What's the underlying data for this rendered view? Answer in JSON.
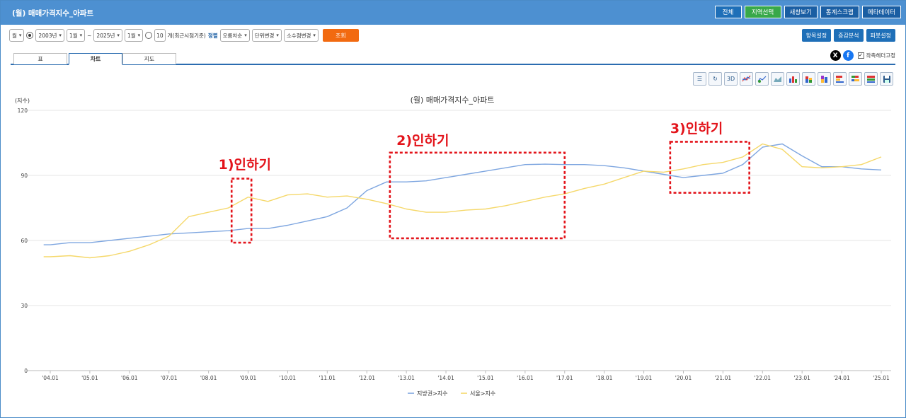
{
  "header": {
    "title": "(월) 매매가격지수_아파트",
    "buttons": [
      "전체",
      "지역선택",
      "새창보기",
      "통계스크랩",
      "메타데이터"
    ]
  },
  "controls": {
    "period": "월",
    "start_year": "2003년",
    "start_month": "1월",
    "tilde": "~",
    "end_year": "2025년",
    "end_month": "1월",
    "count_value": "10",
    "count_label": "개(최근시점기준)",
    "sort_label": "정렬",
    "sort_value": "오름차순",
    "unit_change": "단위변경",
    "decimal_change": "소수점변경",
    "search_button": "조회"
  },
  "right_buttons": [
    "항목설정",
    "증감분석",
    "피봇설정"
  ],
  "tabs": [
    {
      "label": "표",
      "active": false
    },
    {
      "label": "차트",
      "active": true
    },
    {
      "label": "지도",
      "active": false
    }
  ],
  "social": {
    "x_icon": "x-icon",
    "fb_icon": "facebook-icon",
    "fixed_header_label": "좌측헤더고정",
    "fixed_header_checked": true
  },
  "toolbar": [
    "list-icon",
    "refresh-icon",
    "3d-icon",
    "line-chart-icon",
    "line-chart-alt-icon",
    "area-chart-icon",
    "bar-chart-icon",
    "stacked-bar-icon",
    "stacked-bar-alt-icon",
    "horizontal-bar-icon",
    "horizontal-bar-alt-icon",
    "percent-bar-icon",
    "save-icon"
  ],
  "toolbar_text": {
    "three_d": "3D"
  },
  "colors": {
    "header": "#4d90d1",
    "series1": "#7ea6e0",
    "series2": "#f5d86a",
    "annotation": "#e3141b",
    "search": "#f26a10"
  },
  "chart_data": {
    "type": "line",
    "title": "(월) 매매가격지수_아파트",
    "ylabel": "(지수)",
    "ylim": [
      0,
      120
    ],
    "yticks": [
      "120",
      "90",
      "60",
      "30",
      "0"
    ],
    "xticks": [
      "'04.01",
      "'05.01",
      "'06.01",
      "'07.01",
      "'08.01",
      "'09.01",
      "'10.01",
      "'11.01",
      "'12.01",
      "'13.01",
      "'14.01",
      "'15.01",
      "'16.01",
      "'17.01",
      "'18.01",
      "'19.01",
      "'20.01",
      "'21.01",
      "'22.01",
      "'23.01",
      "'24.01",
      "'25.01"
    ],
    "x": [
      "'03.11",
      "'04.01",
      "'04.07",
      "'05.01",
      "'05.07",
      "'06.01",
      "'06.07",
      "'07.01",
      "'07.07",
      "'08.01",
      "'08.07",
      "'09.01",
      "'09.07",
      "'10.01",
      "'10.07",
      "'11.01",
      "'11.07",
      "'12.01",
      "'12.07",
      "'13.01",
      "'13.07",
      "'14.01",
      "'14.07",
      "'15.01",
      "'15.07",
      "'16.01",
      "'16.07",
      "'17.01",
      "'17.07",
      "'18.01",
      "'18.07",
      "'19.01",
      "'19.07",
      "'20.01",
      "'20.07",
      "'21.01",
      "'21.07",
      "'22.01",
      "'22.07",
      "'23.01",
      "'23.07",
      "'24.01",
      "'24.07",
      "'25.01"
    ],
    "series": [
      {
        "name": "지방권>지수",
        "color": "#7ea6e0",
        "values": [
          58,
          58,
          59,
          59,
          60,
          61,
          62,
          63,
          63.5,
          64,
          64.5,
          65.5,
          65.5,
          67,
          69,
          71,
          75,
          83,
          87,
          87,
          87.5,
          89,
          90.5,
          92,
          93.5,
          95,
          95.2,
          95,
          95,
          94.5,
          93.5,
          92,
          90.5,
          89,
          90,
          91,
          95,
          103,
          104.5,
          99,
          94,
          94,
          93,
          92.5
        ]
      },
      {
        "name": "서울>지수",
        "color": "#f5d86a",
        "values": [
          52.5,
          52.5,
          53,
          52,
          53,
          55,
          58,
          62,
          71,
          73,
          75,
          80,
          78,
          81,
          81.5,
          80,
          80.5,
          79,
          77,
          74.5,
          73,
          73,
          74,
          74.5,
          76,
          78,
          80,
          81.5,
          84,
          86,
          89,
          92,
          91.5,
          93,
          95,
          96,
          98.5,
          104.5,
          102,
          94,
          93.5,
          94,
          95,
          98.5
        ]
      }
    ],
    "annotations": [
      "1)인하기",
      "2)인하기",
      "3)인하기"
    ],
    "legend": "bottom-center",
    "grid": true
  }
}
